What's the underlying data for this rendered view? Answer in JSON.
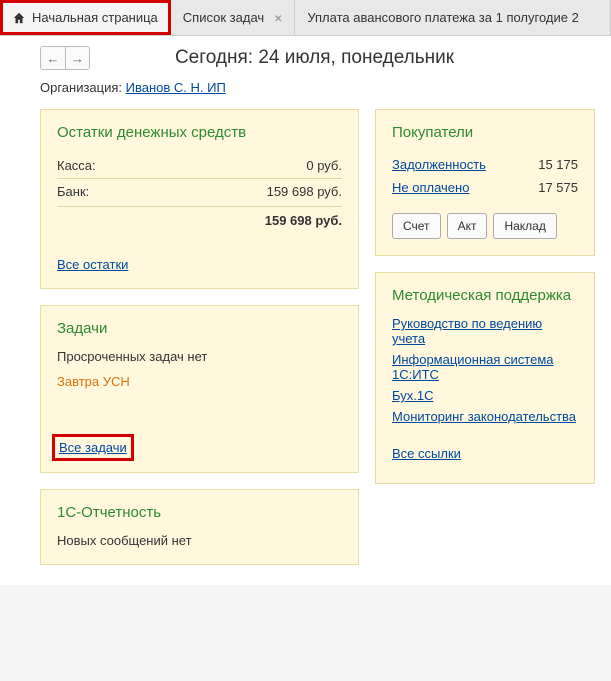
{
  "tabs": {
    "home": "Начальная страница",
    "tasks": "Список задач",
    "payment": "Уплата авансового платежа за 1 полугодие 2"
  },
  "title": "Сегодня: 24 июля, понедельник",
  "org": {
    "label": "Организация:",
    "value": "Иванов С. Н. ИП"
  },
  "balances": {
    "title": "Остатки денежных средств",
    "cash_label": "Касса:",
    "cash_value": "0 руб.",
    "bank_label": "Банк:",
    "bank_value": "159 698 руб.",
    "total": "159 698 руб.",
    "all_link": "Все остатки"
  },
  "tasks": {
    "title": "Задачи",
    "none": "Просроченных задач нет",
    "tomorrow": "Завтра УСН",
    "all_link": "Все задачи"
  },
  "reporting": {
    "title": "1С-Отчетность",
    "none": "Новых сообщений нет"
  },
  "buyers": {
    "title": "Покупатели",
    "debt_label": "Задолженность",
    "debt_value": "15 175",
    "unpaid_label": "Не оплачено",
    "unpaid_value": "17 575",
    "btn_invoice": "Счет",
    "btn_act": "Акт",
    "btn_delivery": "Наклад"
  },
  "support": {
    "title": "Методическая поддержка",
    "link1": "Руководство по ведению учета",
    "link2": "Информационная система 1С:ИТС",
    "link3": "Бух.1С",
    "link4": "Мониторинг законодательства",
    "all_link": "Все ссылки"
  }
}
